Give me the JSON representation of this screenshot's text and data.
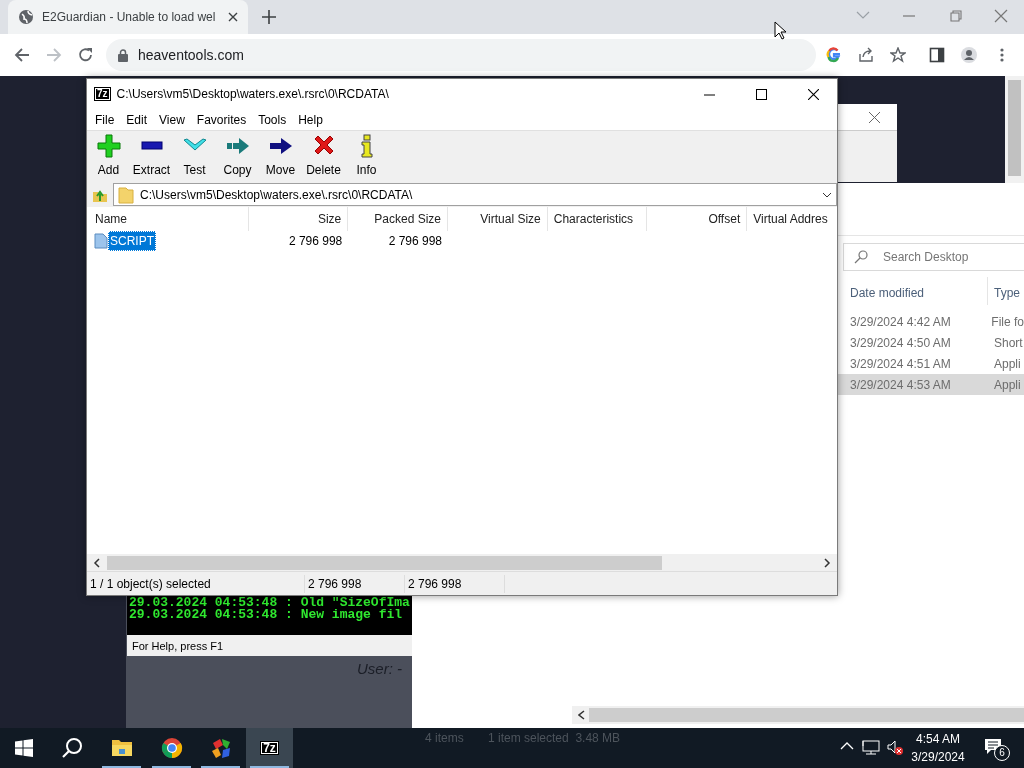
{
  "browser": {
    "tab": {
      "title": "E2Guardian - Unable to load wel",
      "selected": true
    },
    "url": "heaventools.com"
  },
  "background_window": {
    "user_label": "User: -"
  },
  "console": {
    "lines": [
      "29.03.2024 04:53:48 : Old \"SizeOfIma",
      "29.03.2024 04:53:48 : New image fil"
    ],
    "status": "For Help, press F1"
  },
  "explorer": {
    "search_placeholder": "Search Desktop",
    "columns": [
      "Date modified",
      "Type"
    ],
    "rows": [
      {
        "date": "3/29/2024 4:42 AM",
        "type": "File fo",
        "selected": false
      },
      {
        "date": "3/29/2024 4:50 AM",
        "type": "Short",
        "selected": false
      },
      {
        "date": "3/29/2024 4:51 AM",
        "type": "Appli",
        "selected": false
      },
      {
        "date": "3/29/2024 4:53 AM",
        "type": "Appli",
        "selected": true
      }
    ],
    "status": [
      "4 items",
      "1 item selected  3.48 MB"
    ]
  },
  "sevenzip": {
    "logo": "7z",
    "title": "C:\\Users\\vm5\\Desktop\\waters.exe\\.rsrc\\0\\RCDATA\\",
    "menu": [
      "File",
      "Edit",
      "View",
      "Favorites",
      "Tools",
      "Help"
    ],
    "toolbar": [
      {
        "label": "Add",
        "kind": "add"
      },
      {
        "label": "Extract",
        "kind": "extract"
      },
      {
        "label": "Test",
        "kind": "test"
      },
      {
        "label": "Copy",
        "kind": "copy"
      },
      {
        "label": "Move",
        "kind": "move"
      },
      {
        "label": "Delete",
        "kind": "delete"
      },
      {
        "label": "Info",
        "kind": "info"
      }
    ],
    "path": "C:\\Users\\vm5\\Desktop\\waters.exe\\.rsrc\\0\\RCDATA\\",
    "columns": [
      "Name",
      "Size",
      "Packed Size",
      "Virtual Size",
      "Characteristics",
      "Offset",
      "Virtual Addres"
    ],
    "rows": [
      {
        "cells": [
          "SCRIPT",
          "2 796 998",
          "2 796 998",
          "",
          "",
          "",
          ""
        ],
        "selected": true
      }
    ],
    "status": [
      "1 / 1 object(s) selected",
      "2 796 998",
      "2 796 998"
    ]
  },
  "taskbar": {
    "apps": [
      {
        "kind": "explorer",
        "running": true,
        "active": false
      },
      {
        "kind": "chrome",
        "running": true,
        "active": false
      },
      {
        "kind": "colorful",
        "running": true,
        "active": false
      },
      {
        "kind": "sevenzip",
        "label": "7z",
        "running": true,
        "active": true
      }
    ],
    "time": "4:54 AM",
    "date": "3/29/2024",
    "notifications": "6"
  }
}
